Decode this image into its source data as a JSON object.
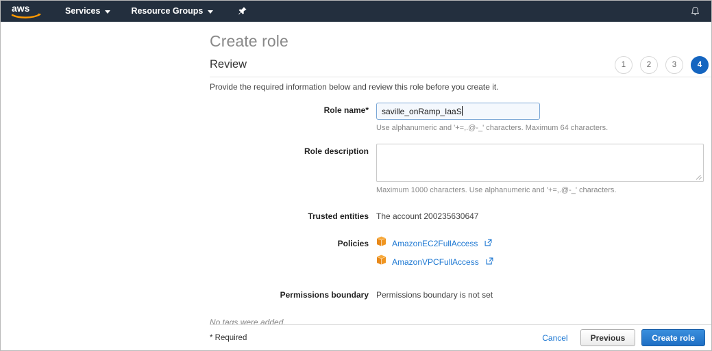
{
  "topnav": {
    "logo_alt": "aws",
    "services_label": "Services",
    "resource_groups_label": "Resource Groups",
    "pin_icon": "pushpin-icon",
    "bell_icon": "bell-icon"
  },
  "page": {
    "title": "Create role",
    "section": "Review",
    "intro": "Provide the required information below and review this role before you create it."
  },
  "steps": [
    {
      "label": "1",
      "active": false
    },
    {
      "label": "2",
      "active": false
    },
    {
      "label": "3",
      "active": false
    },
    {
      "label": "4",
      "active": true
    }
  ],
  "form": {
    "role_name": {
      "label": "Role name*",
      "value": "saville_onRamp_IaaS",
      "placeholder": "",
      "hint": "Use alphanumeric and '+=,.@-_' characters. Maximum 64 characters."
    },
    "role_description": {
      "label": "Role description",
      "value": "",
      "placeholder": "",
      "hint": "Maximum 1000 characters. Use alphanumeric and '+=,.@-_' characters."
    },
    "trusted_entities": {
      "label": "Trusted entities",
      "value": "The account 200235630647"
    },
    "policies": {
      "label": "Policies",
      "items": [
        {
          "name": "AmazonEC2FullAccess",
          "icon": "policy-box-icon",
          "external_icon": "external-link-icon"
        },
        {
          "name": "AmazonVPCFullAccess",
          "icon": "policy-box-icon",
          "external_icon": "external-link-icon"
        }
      ]
    },
    "permissions_boundary": {
      "label": "Permissions boundary",
      "value": "Permissions boundary is not set"
    },
    "tags_note": "No tags were added."
  },
  "footer": {
    "required_note": "* Required",
    "cancel_label": "Cancel",
    "previous_label": "Previous",
    "create_label": "Create role"
  },
  "colors": {
    "navbar": "#232f3e",
    "accent_blue": "#1a76d2",
    "primary_button": "#1f6fc4",
    "step_active": "#1565c0",
    "policy_icon": "#f0951f",
    "aws_orange": "#ff9900"
  }
}
